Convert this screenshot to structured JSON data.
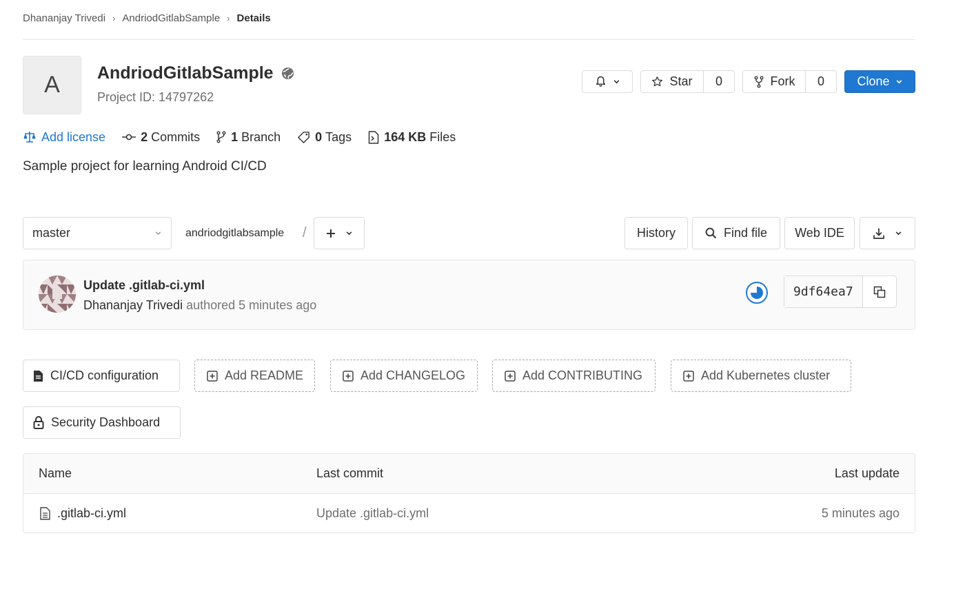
{
  "breadcrumb": [
    "Dhananjay Trivedi",
    "AndriodGitlabSample",
    "Details"
  ],
  "project": {
    "avatar_letter": "A",
    "name": "AndriodGitlabSample",
    "id_text": "Project ID: 14797262",
    "visibility_icon": "globe-icon",
    "description": "Sample project for learning Android CI/CD"
  },
  "actions": {
    "star_label": "Star",
    "star_count": "0",
    "fork_label": "Fork",
    "fork_count": "0",
    "clone_label": "Clone"
  },
  "stats": {
    "license": "Add license",
    "commits_count": "2",
    "commits_label": "Commits",
    "branch_count": "1",
    "branch_label": "Branch",
    "tags_count": "0",
    "tags_label": "Tags",
    "files_size": "164 KB",
    "files_label": "Files"
  },
  "repo_toolbar": {
    "branch": "master",
    "path": "andriodgitlabsample",
    "path_separator": "/",
    "history": "History",
    "find_file": "Find file",
    "web_ide": "Web IDE"
  },
  "last_commit": {
    "title": "Update .gitlab-ci.yml",
    "author": "Dhananjay Trivedi",
    "meta": "authored 5 minutes ago",
    "sha": "9df64ea7"
  },
  "shortcuts": {
    "cicd": "CI/CD configuration",
    "readme": "Add README",
    "changelog": "Add CHANGELOG",
    "contributing": "Add CONTRIBUTING",
    "kubernetes": "Add Kubernetes cluster",
    "security": "Security Dashboard"
  },
  "files_table": {
    "headers": [
      "Name",
      "Last commit",
      "Last update"
    ],
    "rows": [
      {
        "name": ".gitlab-ci.yml",
        "last_commit": "Update .gitlab-ci.yml",
        "last_update": "5 minutes ago"
      }
    ]
  },
  "colors": {
    "primary": "#1f78d1",
    "border": "#dbdbdb",
    "text": "#2e2e2e",
    "muted": "#6e6e6e"
  }
}
